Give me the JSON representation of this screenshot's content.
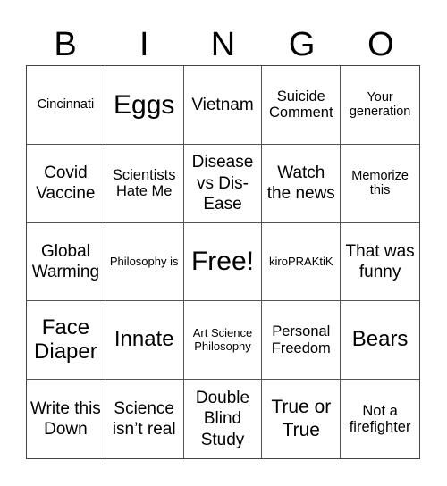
{
  "header": [
    "B",
    "I",
    "N",
    "G",
    "O"
  ],
  "cells": [
    "Cincinnati",
    "Eggs",
    "Vietnam",
    "Suicide Comment",
    "Your generation",
    "Covid Vaccine",
    "Scientists Hate Me",
    "Disease vs Dis-Ease",
    "Watch the news",
    "Memorize this",
    "Global Warming",
    "Philosophy is",
    "Free!",
    "kiroPRAKtiK",
    "That was funny",
    "Face Diaper",
    "Innate",
    "Art Science Philosophy",
    "Personal Freedom",
    "Bears",
    "Write this Down",
    "Science isn’t real",
    "Double Blind Study",
    "True or True",
    "Not a firefighter"
  ]
}
